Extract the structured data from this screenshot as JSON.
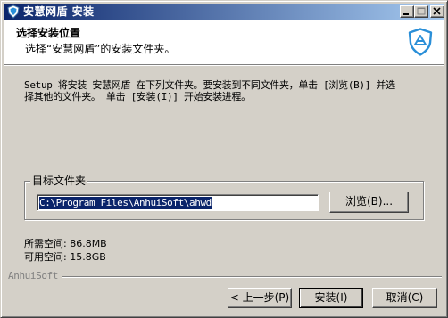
{
  "window": {
    "title": "安慧网盾 安装",
    "controls": [
      "minimize",
      "maximize",
      "close"
    ]
  },
  "header": {
    "title": "选择安装位置",
    "subtitle": "选择“安慧网盾”的安装文件夹。",
    "logo_icon": "shield-icon"
  },
  "description": "Setup 将安装 安慧网盾 在下列文件夹。要安装到不同文件夹，单击 [浏览(B)] 并选\n择其他的文件夹。 单击 [安装(I)] 开始安装进程。",
  "destination": {
    "group_label": "目标文件夹",
    "path": "C:\\Program Files\\AnhuiSoft\\ahwd",
    "browse_label": "浏览(B)..."
  },
  "space": {
    "required": "所需空间: 86.8MB",
    "available": "可用空间: 15.8GB"
  },
  "brand": "AnhuiSoft",
  "buttons": {
    "back": "< 上一步(P)",
    "install": "安装(I)",
    "cancel": "取消(C)"
  },
  "colors": {
    "title_bar_start": "#0a246a",
    "title_bar_end": "#a6caf0",
    "logo": "#2a8fd8"
  }
}
